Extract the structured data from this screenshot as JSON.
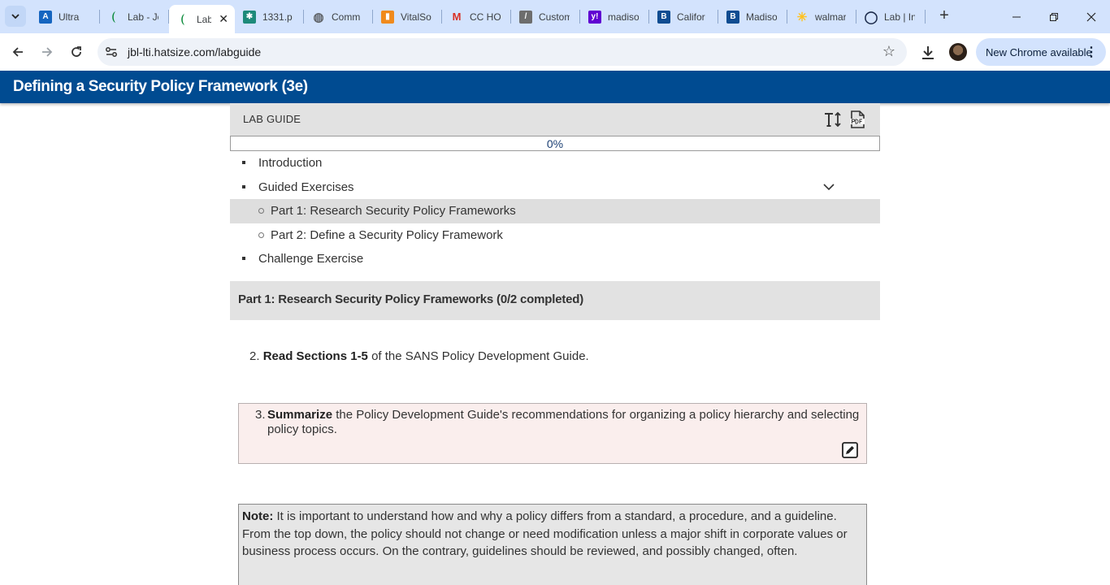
{
  "browser": {
    "tabs": [
      {
        "title": "Ultra",
        "favicon": "blackboard-ultra-icon",
        "color": "#1565c0",
        "glyph": "A"
      },
      {
        "title": "Lab - Jo",
        "favicon": "lab-leaf-icon",
        "color": "#0a8a3a",
        "glyph": ""
      },
      {
        "title": "Lab",
        "favicon": "lab-leaf-icon",
        "color": "#0a8a3a",
        "glyph": "",
        "active": true
      },
      {
        "title": "1331.p",
        "favicon": "spreadsheet-icon",
        "color": "#1d8a7a",
        "glyph": "✱"
      },
      {
        "title": "Comm",
        "favicon": "globe-icon",
        "color": "#5f6368",
        "glyph": "◍"
      },
      {
        "title": "VitalSo",
        "favicon": "vitalsource-icon",
        "color": "#f08a1c",
        "glyph": "▮"
      },
      {
        "title": "CC HOA",
        "favicon": "gmail-icon",
        "color": "#ffffff",
        "glyph": "M"
      },
      {
        "title": "Custom",
        "favicon": "slash-icon",
        "color": "#6d6d6d",
        "glyph": "/"
      },
      {
        "title": "madiso",
        "favicon": "yahoo-icon",
        "color": "#6001d2",
        "glyph": "y!"
      },
      {
        "title": "Califor",
        "favicon": "bing-b-icon",
        "color": "#0f4c91",
        "glyph": "B"
      },
      {
        "title": "Madiso",
        "favicon": "bing-b-icon",
        "color": "#0f4c91",
        "glyph": "B"
      },
      {
        "title": "walmar",
        "favicon": "walmart-spark-icon",
        "color": "#ffc220",
        "glyph": "✳"
      },
      {
        "title": "Lab | In",
        "favicon": "circle-logo-icon",
        "color": "#1b2a4a",
        "glyph": "◯"
      }
    ],
    "close_glyph": "✕",
    "new_tab_glyph": "+",
    "url": "jbl-lti.hatsize.com/labguide",
    "chrome_update_label": "New Chrome available",
    "colors": {
      "tabstrip": "#d3e3fd",
      "omnibox": "#eef2f8"
    }
  },
  "app": {
    "title": "Defining a Security Policy Framework (3e)",
    "header_color": "#004b91"
  },
  "guide": {
    "label": "LAB GUIDE",
    "progress_text": "0%",
    "progress_fraction": 0,
    "toc": [
      {
        "label": "Introduction",
        "level": 1
      },
      {
        "label": "Guided Exercises",
        "level": 1,
        "expanded": true
      },
      {
        "label": "Part 1: Research Security Policy Frameworks",
        "level": 2,
        "selected": true
      },
      {
        "label": "Part 2: Define a Security Policy Framework",
        "level": 2
      },
      {
        "label": "Challenge Exercise",
        "level": 1
      }
    ],
    "section_title": "Part 1: Research Security Policy Frameworks (0/2 completed)",
    "steps": [
      {
        "number": "2.",
        "bold": "Read Sections 1-5",
        "text": " of the SANS Policy Development Guide."
      },
      {
        "number": "3.",
        "bold": "Summarize",
        "text": " the Policy Development Guide's recommendations for organizing a policy hierarchy and selecting policy topics."
      }
    ],
    "note": {
      "label": "Note:",
      "text": " It is important to understand how and why a policy differs from a standard, a procedure, and a guideline. From the top down, the policy should not change or need modification unless a major shift in corporate values or business process occurs. On the contrary, guidelines should be reviewed, and possibly changed, often."
    }
  }
}
